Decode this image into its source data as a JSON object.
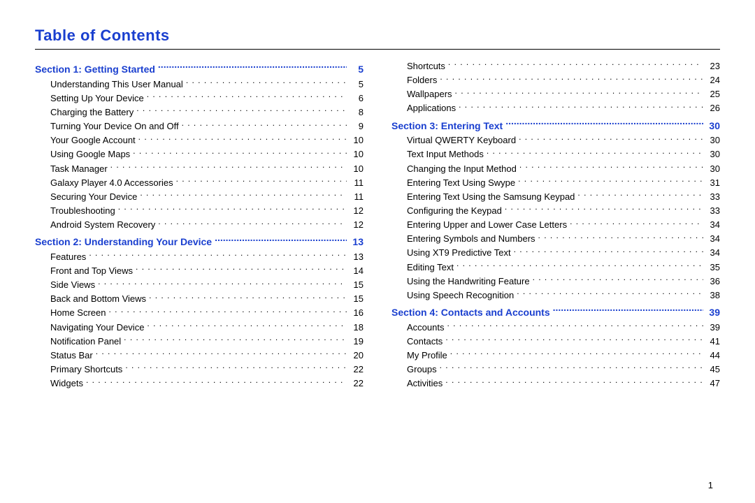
{
  "title": "Table of Contents",
  "page_number": "1",
  "left_column": [
    {
      "type": "section",
      "label": "Section 1:  Getting Started",
      "page": "5"
    },
    {
      "type": "entry",
      "label": "Understanding This User Manual",
      "page": "5"
    },
    {
      "type": "entry",
      "label": "Setting Up Your Device",
      "page": "6"
    },
    {
      "type": "entry",
      "label": "Charging the Battery",
      "page": "8"
    },
    {
      "type": "entry",
      "label": "Turning Your Device On and Off",
      "page": "9"
    },
    {
      "type": "entry",
      "label": "Your Google Account",
      "page": "10"
    },
    {
      "type": "entry",
      "label": "Using Google Maps",
      "page": "10"
    },
    {
      "type": "entry",
      "label": "Task Manager",
      "page": "10"
    },
    {
      "type": "entry",
      "label": "Galaxy Player 4.0 Accessories",
      "page": "11"
    },
    {
      "type": "entry",
      "label": "Securing Your Device",
      "page": "11"
    },
    {
      "type": "entry",
      "label": "Troubleshooting",
      "page": "12"
    },
    {
      "type": "entry",
      "label": "Android System Recovery",
      "page": "12"
    },
    {
      "type": "section",
      "label": "Section 2:  Understanding Your Device",
      "page": "13"
    },
    {
      "type": "entry",
      "label": "Features",
      "page": "13"
    },
    {
      "type": "entry",
      "label": "Front and Top Views",
      "page": "14"
    },
    {
      "type": "entry",
      "label": "Side Views",
      "page": "15"
    },
    {
      "type": "entry",
      "label": "Back and Bottom Views",
      "page": "15"
    },
    {
      "type": "entry",
      "label": "Home Screen",
      "page": "16"
    },
    {
      "type": "entry",
      "label": "Navigating Your Device",
      "page": "18"
    },
    {
      "type": "entry",
      "label": "Notification Panel",
      "page": "19"
    },
    {
      "type": "entry",
      "label": "Status Bar",
      "page": "20"
    },
    {
      "type": "entry",
      "label": "Primary Shortcuts",
      "page": "22"
    },
    {
      "type": "entry",
      "label": "Widgets",
      "page": "22"
    }
  ],
  "right_column": [
    {
      "type": "entry",
      "label": "Shortcuts",
      "page": "23"
    },
    {
      "type": "entry",
      "label": "Folders",
      "page": "24"
    },
    {
      "type": "entry",
      "label": "Wallpapers",
      "page": "25"
    },
    {
      "type": "entry",
      "label": "Applications",
      "page": "26"
    },
    {
      "type": "section",
      "label": "Section 3:  Entering Text",
      "page": "30"
    },
    {
      "type": "entry",
      "label": "Virtual QWERTY Keyboard",
      "page": "30"
    },
    {
      "type": "entry",
      "label": "Text Input Methods",
      "page": "30"
    },
    {
      "type": "entry",
      "label": "Changing the Input Method",
      "page": "30"
    },
    {
      "type": "entry",
      "label": "Entering Text Using Swype",
      "page": "31"
    },
    {
      "type": "entry",
      "label": "Entering Text Using the Samsung Keypad",
      "page": "33"
    },
    {
      "type": "entry",
      "label": "Configuring the Keypad",
      "page": "33"
    },
    {
      "type": "entry",
      "label": "Entering Upper and Lower Case Letters",
      "page": "34"
    },
    {
      "type": "entry",
      "label": "Entering Symbols and Numbers",
      "page": "34"
    },
    {
      "type": "entry",
      "label": "Using XT9 Predictive Text",
      "page": "34"
    },
    {
      "type": "entry",
      "label": "Editing Text",
      "page": "35"
    },
    {
      "type": "entry",
      "label": "Using the Handwriting Feature",
      "page": "36"
    },
    {
      "type": "entry",
      "label": "Using Speech Recognition",
      "page": "38"
    },
    {
      "type": "section",
      "label": "Section 4:  Contacts and Accounts",
      "page": "39"
    },
    {
      "type": "entry",
      "label": "Accounts",
      "page": "39"
    },
    {
      "type": "entry",
      "label": "Contacts",
      "page": "41"
    },
    {
      "type": "entry",
      "label": "My Profile",
      "page": "44"
    },
    {
      "type": "entry",
      "label": "Groups",
      "page": "45"
    },
    {
      "type": "entry",
      "label": "Activities",
      "page": "47"
    }
  ]
}
